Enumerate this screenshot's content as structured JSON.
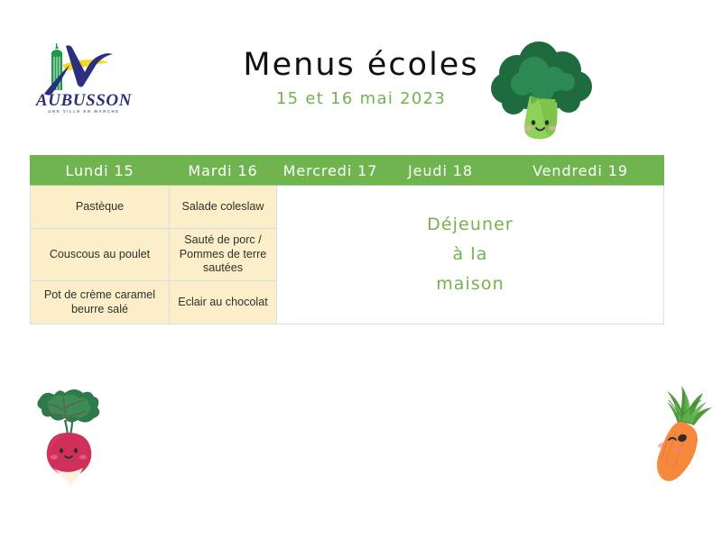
{
  "header": {
    "title": "Menus écoles",
    "subtitle": "15 et 16 mai 2023",
    "logo": {
      "word": "AUBUSSON",
      "tagline": "UNE VILLE EN MARCHE",
      "name": "aubusson-logo"
    },
    "decor_icon": "broccoli-icon"
  },
  "table": {
    "columns": [
      {
        "label": "Lundi 15"
      },
      {
        "label": "Mardi 16"
      },
      {
        "label": "Mercredi 17"
      },
      {
        "label": "Jeudi 18"
      },
      {
        "label": "Vendredi 19"
      }
    ],
    "rows": [
      {
        "name": "entree",
        "cells": [
          "Pastèque",
          "Salade coleslaw"
        ]
      },
      {
        "name": "plat",
        "cells": [
          "Couscous au poulet",
          "Sauté de porc / Pommes de terre sautées"
        ]
      },
      {
        "name": "dessert",
        "cells": [
          "Pot de crème caramel beurre salé",
          "Eclair au chocolat"
        ]
      }
    ],
    "merged_cell": {
      "line1": "Déjeuner",
      "line2": "à la",
      "line3": "maison"
    }
  },
  "decor": {
    "radish_icon": "radish-icon",
    "carrot_icon": "carrot-icon"
  },
  "colors": {
    "green": "#70b44f",
    "cream": "#fceec8",
    "logo_blue": "#2b2f7e",
    "logo_yellow": "#f5d928",
    "logo_green": "#1f9a4a",
    "text_dark": "#2f2f2f",
    "border": "#cfe0ee"
  }
}
